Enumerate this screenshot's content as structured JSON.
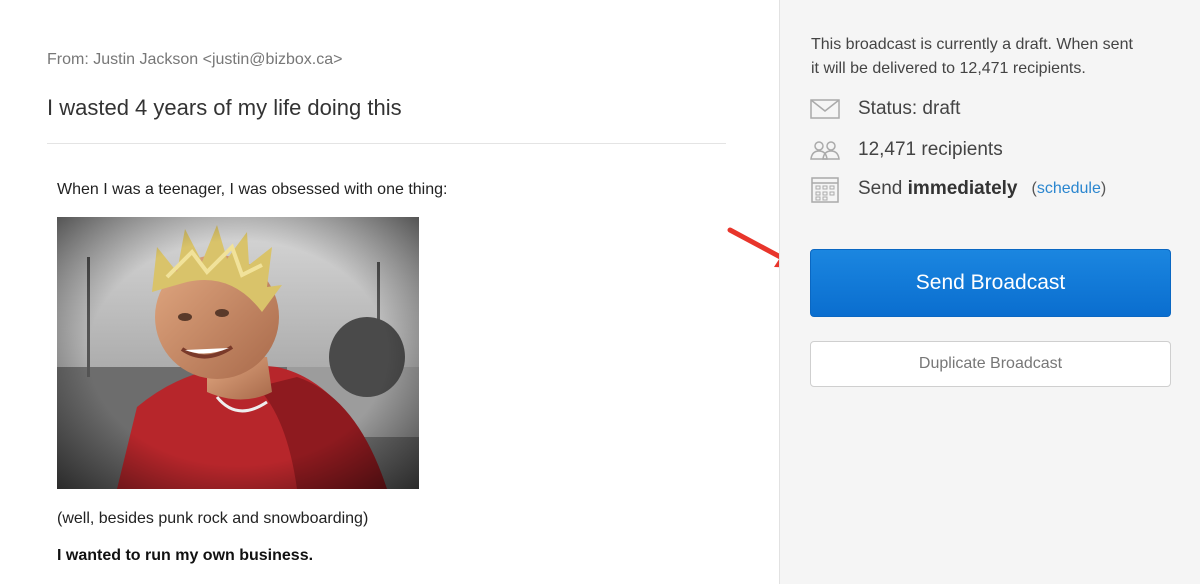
{
  "email": {
    "from": "From: Justin Jackson <justin@bizbox.ca>",
    "subject": "I wasted 4 years of my life doing this",
    "body": {
      "paragraph_1": "When I was a teenager, I was obsessed with one thing:",
      "paragraph_2": "(well, besides punk rock and snowboarding)",
      "paragraph_3": "I wanted to run my own business."
    }
  },
  "sidebar": {
    "info_text": "This broadcast is currently a draft. When sent it will be delivered to 12,471 recipients.",
    "status": {
      "icon": "envelope-icon",
      "label": "Status: draft"
    },
    "recipients": {
      "icon": "people-icon",
      "label": "12,471 recipients"
    },
    "send_time": {
      "icon": "calendar-icon",
      "prefix": "Send",
      "value": "immediately",
      "paren_open": "(",
      "schedule_link": "schedule",
      "paren_close": ")"
    },
    "send_button": "Send Broadcast",
    "duplicate_button": "Duplicate Broadcast"
  },
  "colors": {
    "primary_button": "#0f78d6",
    "link": "#2a86cf",
    "arrow": "#e8352b",
    "sidebar_bg": "#f5f5f5"
  }
}
